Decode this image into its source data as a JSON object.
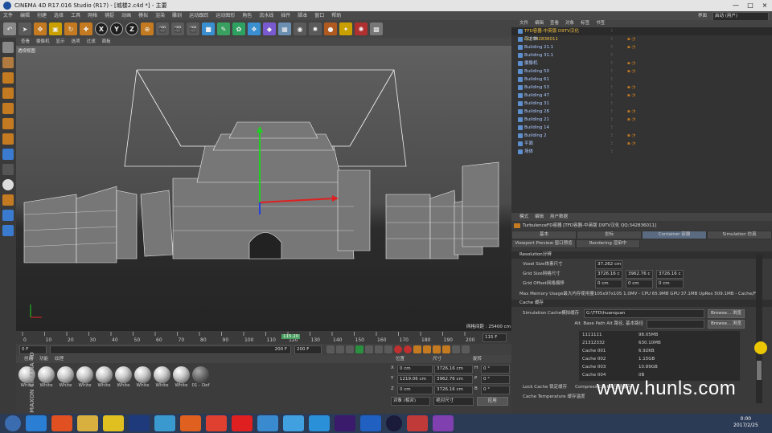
{
  "window": {
    "title": "CINEMA 4D R17.016 Studio (R17) - [城楼2.c4d *] - 主要",
    "controls": [
      "—",
      "□",
      "×"
    ]
  },
  "menu": [
    "文件",
    "编辑",
    "创建",
    "选择",
    "工具",
    "网格",
    "捕捉",
    "动画",
    "模拟",
    "渲染",
    "雕刻",
    "运动跟踪",
    "运动图形",
    "角色",
    "流水线",
    "插件",
    "脚本",
    "窗口",
    "帮助"
  ],
  "toolbar": {
    "xyz": [
      "X",
      "Y",
      "Z"
    ]
  },
  "viewport": {
    "menu": [
      "查看",
      "摄像机",
      "显示",
      "选项",
      "过滤",
      "面板"
    ],
    "label": "透视视图",
    "grid": "网格间距 : 25400 cm"
  },
  "timeline": {
    "ticks": [
      "0",
      "10",
      "20",
      "30",
      "40",
      "50",
      "60",
      "70",
      "80",
      "90",
      "100",
      "110",
      "120",
      "130",
      "140",
      "150",
      "160",
      "170",
      "180",
      "190",
      "200"
    ],
    "current": "115.20",
    "end_frame": "115 F"
  },
  "transport": {
    "start": "0 F",
    "range": "200 F",
    "end": "200 F"
  },
  "materials": {
    "menu": [
      "创建",
      "功能",
      "纹理"
    ],
    "items": [
      "White",
      "White",
      "White",
      "White",
      "White",
      "White",
      "White",
      "White",
      "White",
      "01 - Def"
    ],
    "brand": "MAXON CINEMA 4D"
  },
  "coords": {
    "headers": [
      "位置",
      "尺寸",
      "旋转"
    ],
    "rows": [
      [
        "X",
        "0 cm",
        "3726.16 cm",
        "H",
        "0 °"
      ],
      [
        "Y",
        "1219.06 cm",
        "3962.76 cm",
        "P",
        "0 °"
      ],
      [
        "Z",
        "0 cm",
        "3726.16 cm",
        "B",
        "0 °"
      ]
    ],
    "mode": "对象 (相对)",
    "size_mode": "绝对尺寸",
    "apply": "应用"
  },
  "objects": {
    "menu": [
      "文件",
      "编辑",
      "查看",
      "对象",
      "标签",
      "书签"
    ],
    "rows": [
      "TFD容器-中英版 D9TV汉化 QQ:342836011",
      "三方体",
      "Building 21.1",
      "Building 31.1",
      "摄像机",
      "Building 50",
      "Building 61",
      "Building 53",
      "Building 47",
      "Building 31",
      "Building 28",
      "Building 21",
      "Building 14",
      "Building 2",
      "平面",
      "场体"
    ],
    "top_right": "界面",
    "top_right_val": "启动 (用户)"
  },
  "attributes": {
    "menu": [
      "模式",
      "编辑",
      "用户数据"
    ],
    "object": "TurbulenceFD容器 [TFD容器-中英版 D9TV汉化 QQ:342836011]",
    "tabs": [
      "基本",
      "坐标",
      "Container 容器",
      "Simulation 仿真"
    ],
    "tabs2": [
      "Viewport Preview 窗口预览",
      "Rendering 渲染中"
    ],
    "res_section": "Resolution分辨",
    "voxel_label": "Voxel Size体素尺寸",
    "voxel": "37.262 cm",
    "grid_label": "Grid Size网格尺寸",
    "grid": [
      "3726.16 c",
      "3962.76 c",
      "3726.16 c"
    ],
    "offset_label": "Grid Offset网格偏移",
    "offset": [
      "0 cm",
      "0 cm",
      "0 cm"
    ],
    "mem": "Max Memory Usage最大内存使用量105x97x105 1.0MV - CPU 65.9MB GPU 37.1MB UpRes 509.1MB - Cache/F: 4.",
    "cache_section": "Cache 缓存",
    "sim_label": "Simulation Cache模拟缓存",
    "sim_path": "G:\\TFD\\huanquan",
    "browse": "Browse... 浏览",
    "alt_label": "Alt. Base Path Alt 路径, 基本路径",
    "list": [
      [
        "1111111",
        "98.05MB"
      ],
      [
        "21312332",
        "630.10MB"
      ],
      [
        "Cache 001",
        "6.92KB"
      ],
      [
        "Cache 002",
        "1.15GB"
      ],
      [
        "Cache 003",
        "10.89GB"
      ],
      [
        "Cache 004",
        "0B"
      ]
    ],
    "lock": "Lock Cache 锁定缓存",
    "compress": "Compress Cache 压缩缓存",
    "temp": "Cache Temperature 缓存温度"
  },
  "watermark": "www.hunls.com",
  "taskbar": {
    "time": "0:00",
    "date": "2017/2/25"
  }
}
